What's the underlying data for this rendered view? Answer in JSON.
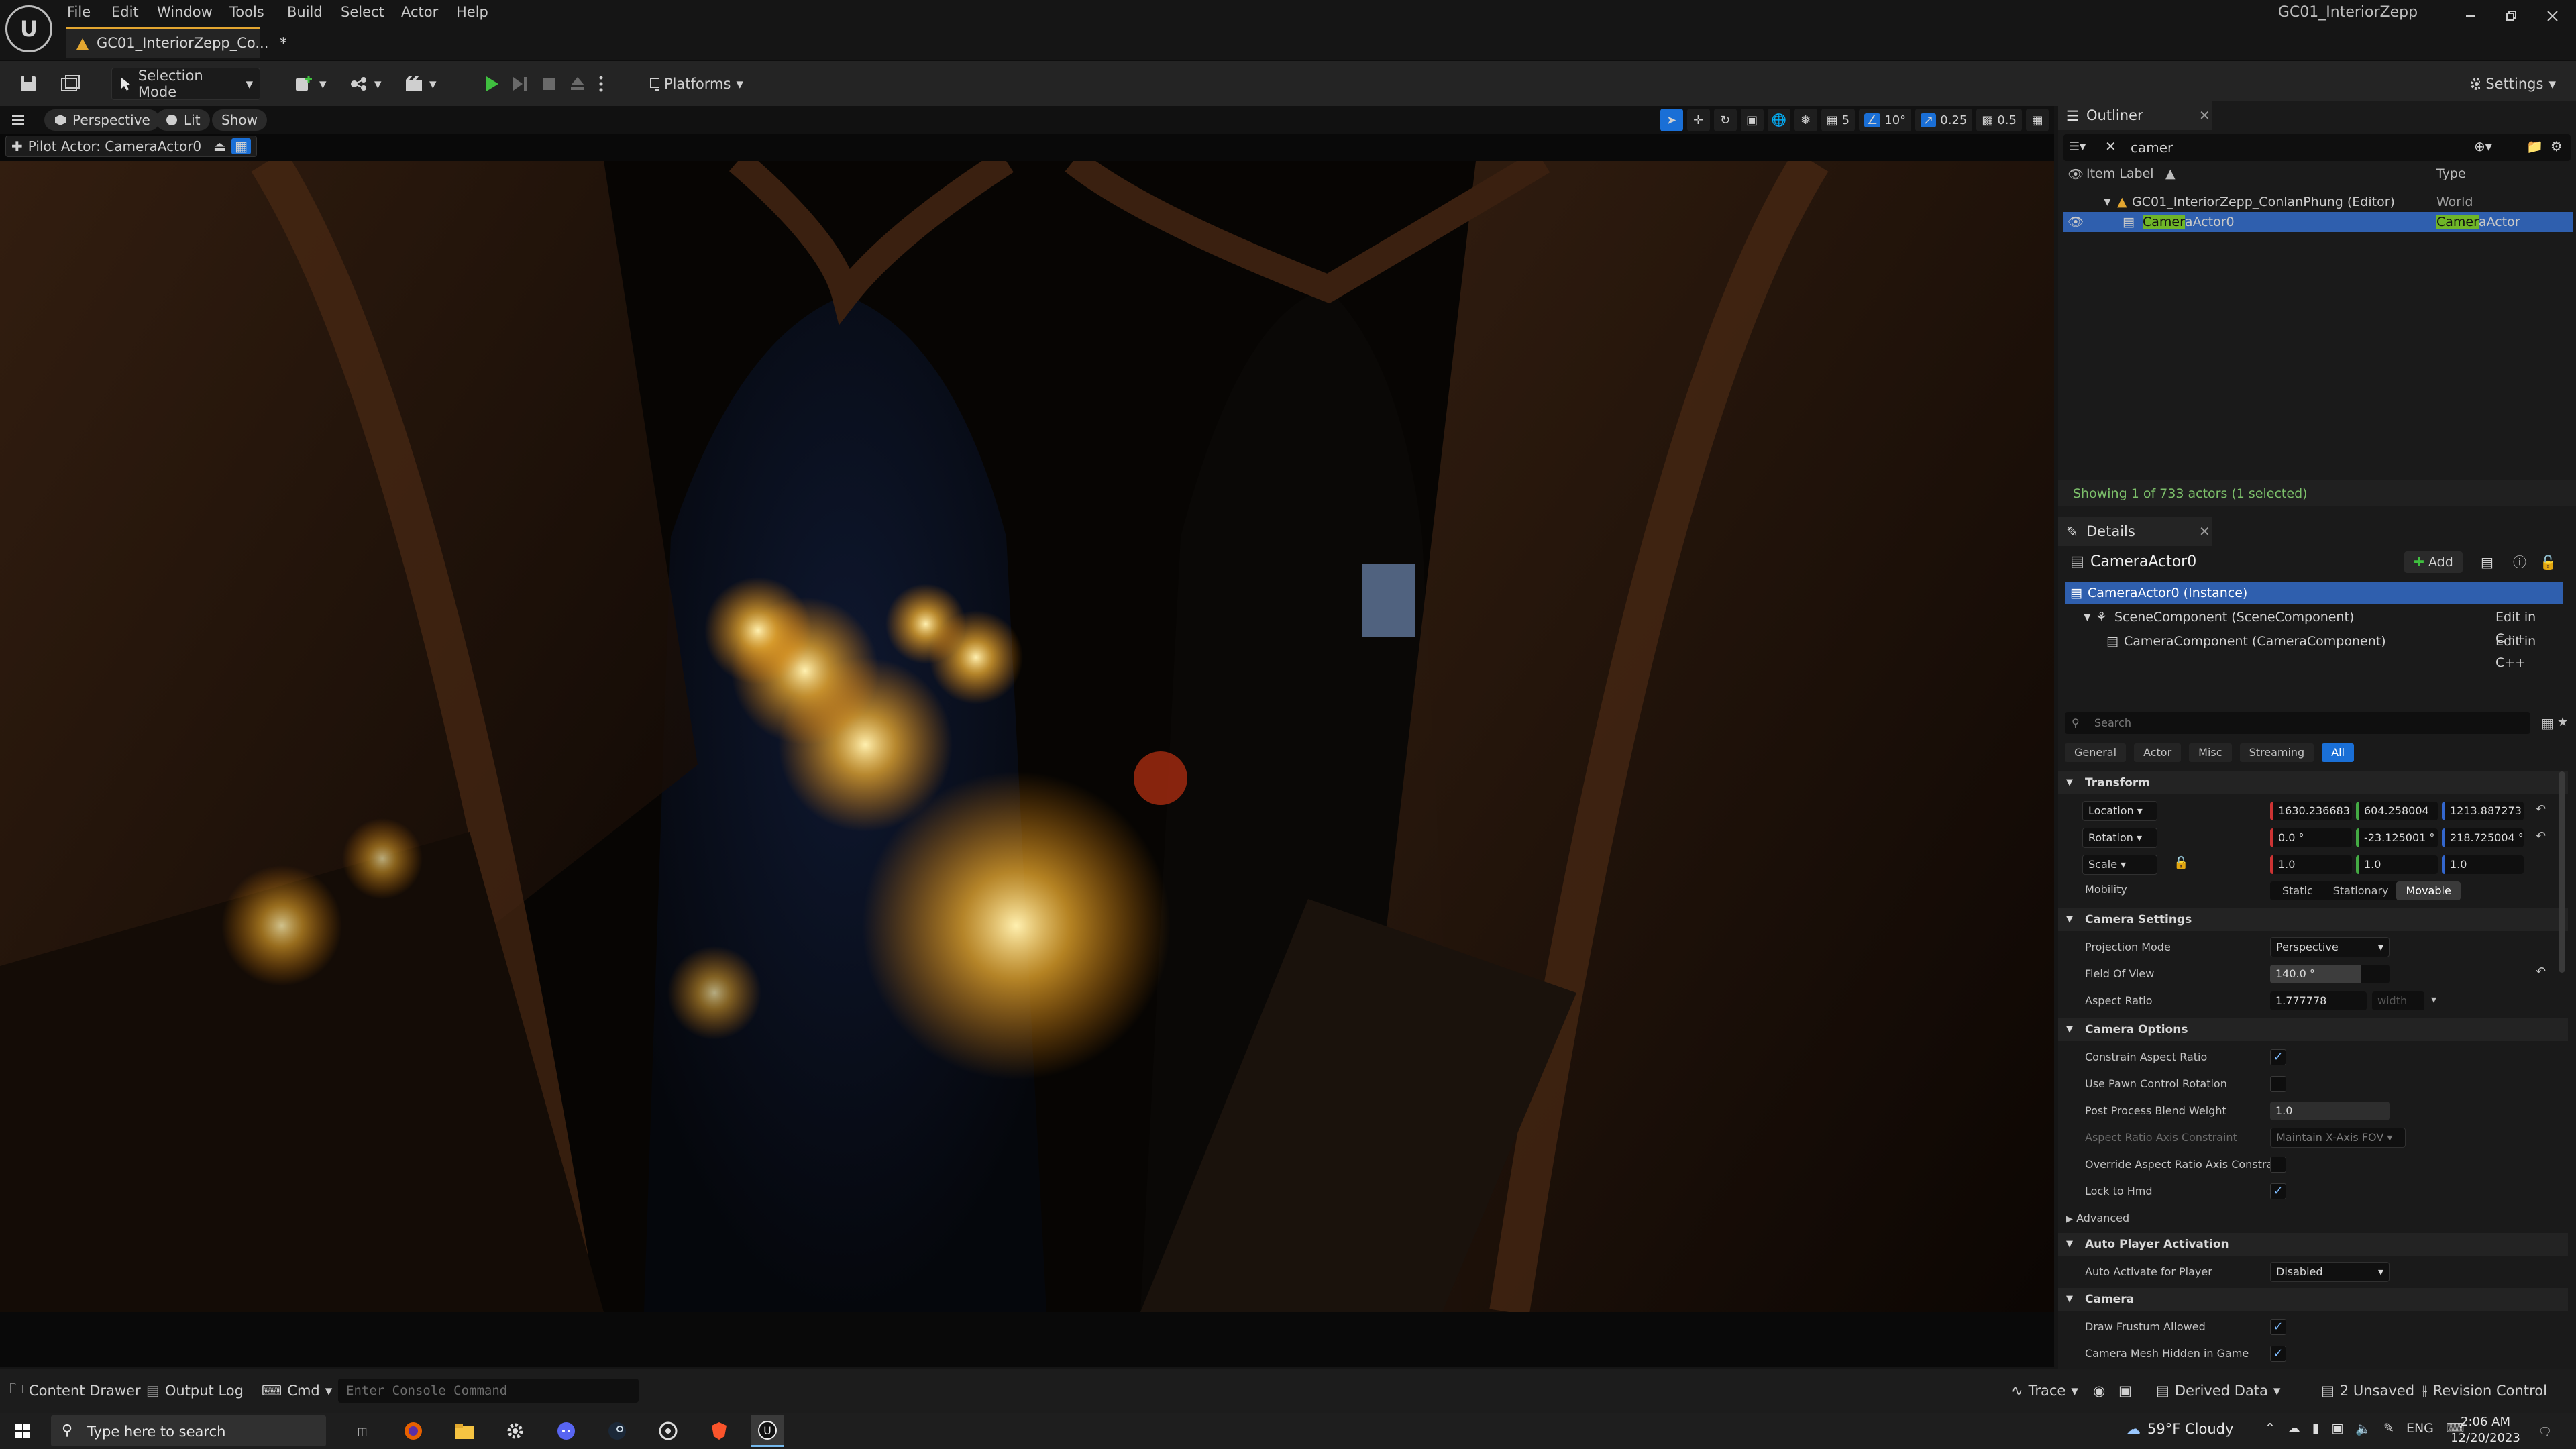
{
  "app": {
    "window_title": "GC01_InteriorZepp"
  },
  "menu": [
    "File",
    "Edit",
    "Window",
    "Tools",
    "Build",
    "Select",
    "Actor",
    "Help"
  ],
  "document_tab": {
    "label": "GC01_InteriorZepp_Co...",
    "modified_marker": "*"
  },
  "toolbar": {
    "selection_mode": "Selection Mode",
    "platforms": "Platforms",
    "settings": "Settings"
  },
  "viewport": {
    "perspective": "Perspective",
    "lit": "Lit",
    "show": "Show",
    "pilot_label": "Pilot Actor: CameraActor0",
    "grid_snap": "5",
    "angle_snap": "10°",
    "scale_snap": "0.25",
    "camera_speed": "0.5"
  },
  "outliner": {
    "tab": "Outliner",
    "search_value": "camer",
    "col_label": "Item Label",
    "col_type": "Type",
    "rows": [
      {
        "label": "GC01_InteriorZepp_ConlanPhung (Editor)",
        "type": "World"
      },
      {
        "label_highlight": "Camer",
        "label_rest": "aActor0",
        "type_highlight": "Camer",
        "type_rest": "aActor"
      }
    ],
    "status": "Showing 1 of 733 actors (1 selected)"
  },
  "details": {
    "tab": "Details",
    "actor_name": "CameraActor0",
    "add_label": "Add",
    "components": [
      {
        "label": "CameraActor0 (Instance)",
        "action": ""
      },
      {
        "label": "SceneComponent (SceneComponent)",
        "action": "Edit in C++"
      },
      {
        "label": "CameraComponent (CameraComponent)",
        "action": "Edit in C++"
      }
    ],
    "search_placeholder": "Search",
    "filters": [
      "General",
      "Actor",
      "Misc",
      "Streaming",
      "All"
    ],
    "transform": {
      "category": "Transform",
      "location_label": "Location",
      "location": [
        "1630.236683",
        "604.258004",
        "1213.887273"
      ],
      "rotation_label": "Rotation",
      "rotation": [
        "0.0 °",
        "-23.125001 °",
        "218.725004 °"
      ],
      "scale_label": "Scale",
      "scale": [
        "1.0",
        "1.0",
        "1.0"
      ],
      "mobility_label": "Mobility",
      "mobility": [
        "Static",
        "Stationary",
        "Movable"
      ]
    },
    "camera_settings": {
      "category": "Camera Settings",
      "projection_label": "Projection Mode",
      "projection_value": "Perspective",
      "fov_label": "Field Of View",
      "fov_value": "140.0 °",
      "aspect_label": "Aspect Ratio",
      "aspect_value": "1.777778",
      "aspect_width_placeholder": "width"
    },
    "camera_options": {
      "category": "Camera Options",
      "constrain": "Constrain Aspect Ratio",
      "pawn_rotation": "Use Pawn Control Rotation",
      "blend_label": "Post Process Blend Weight",
      "blend_value": "1.0",
      "axis_constraint": "Aspect Ratio Axis Constraint",
      "axis_value": "Maintain X-Axis FOV",
      "override_axis": "Override Aspect Ratio Axis Constra...",
      "lock_hmd": "Lock to Hmd",
      "advanced": "Advanced"
    },
    "auto_player": {
      "category": "Auto Player Activation",
      "label": "Auto Activate for Player",
      "value": "Disabled"
    },
    "camera": {
      "category": "Camera",
      "frustum": "Draw Frustum Allowed",
      "mesh_hidden": "Camera Mesh Hidden in Game"
    }
  },
  "status_bar": {
    "content_drawer": "Content Drawer",
    "output_log": "Output Log",
    "cmd": "Cmd",
    "console_placeholder": "Enter Console Command",
    "trace": "Trace",
    "derived_data": "Derived Data",
    "unsaved": "2 Unsaved",
    "revision": "Revision Control"
  },
  "taskbar": {
    "search_placeholder": "Type here to search",
    "weather": "59°F  Cloudy",
    "lang": "ENG",
    "time": "2:06 AM",
    "date": "12/20/2023"
  },
  "colors": {
    "accent_blue": "#1a6fd6",
    "selection_row": "#2f5fae",
    "search_highlight": "#6fb628",
    "play_green": "#3fbf3f"
  }
}
